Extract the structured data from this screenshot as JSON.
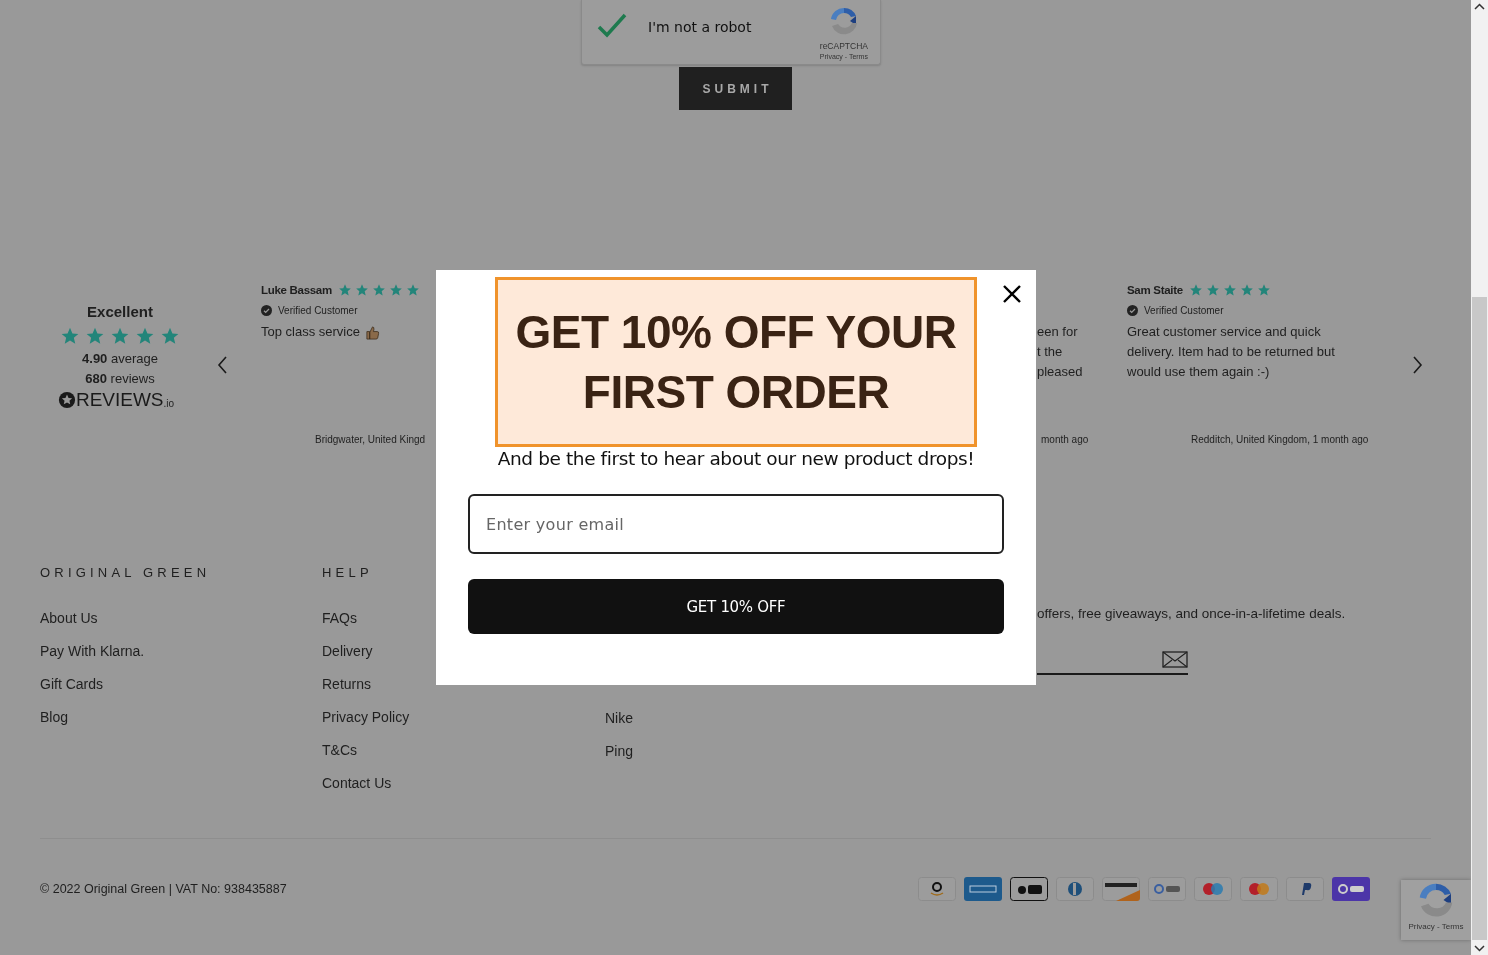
{
  "captcha": {
    "label": "I'm not a robot",
    "checked": true,
    "brand": "reCAPTCHA",
    "links": "Privacy - Terms"
  },
  "submit_button": "SUBMIT",
  "reviews": {
    "summary": {
      "rating_word": "Excellent",
      "stars": 5,
      "average": "**4.90** average",
      "count": "**680** reviews",
      "logo": "REVIEWS",
      "logo_suffix": ".io"
    },
    "items": [
      {
        "name": "Luke Bassam",
        "stars": 5,
        "badge": "Verified Customer",
        "text": "Top class service",
        "thumbs_up": true,
        "location": "Bridgwater, United Kingd"
      },
      {
        "name": "Sam Staite",
        "stars": 5,
        "badge": "Verified Customer",
        "text": "Great customer service and quick delivery. Item had to be returned but would use them again :-)",
        "thumbs_up": false,
        "location": "Redditch, United Kingdom, 1 month ago"
      }
    ],
    "partial_review": {
      "lines": [
        "een for",
        "t the",
        "pleased"
      ],
      "time": "month ago"
    }
  },
  "footer": {
    "columns": [
      {
        "heading": "ORIGINAL GREEN",
        "links": [
          "About Us",
          "Pay With Klarna.",
          "Gift Cards",
          "Blog"
        ]
      },
      {
        "heading": "HELP",
        "links": [
          "FAQs",
          "Delivery",
          "Returns",
          "Privacy Policy",
          "T&Cs",
          "Contact Us"
        ]
      },
      {
        "links": [
          "Nike",
          "Ping"
        ]
      }
    ],
    "newsletter": {
      "text": "offers, free giveaways, and once-in-a-lifetime deals."
    },
    "copyright": "© 2022 Original Green | VAT No: 938435887",
    "payment_methods": [
      {
        "kind": "amazon"
      },
      {
        "kind": "amex"
      },
      {
        "kind": "applepay"
      },
      {
        "kind": "diners"
      },
      {
        "kind": "discover"
      },
      {
        "kind": "googlepay"
      },
      {
        "kind": "maestro"
      },
      {
        "kind": "mastercard"
      },
      {
        "kind": "paypal"
      },
      {
        "kind": "shoppay"
      }
    ]
  },
  "recaptcha_badge": {
    "links": "Privacy - Terms"
  },
  "popup": {
    "heading": "GET 10% OFF YOUR FIRST ORDER",
    "subheading": "And be the first to hear about our new product drops!",
    "email_placeholder": "Enter your email",
    "button": "GET 10% OFF"
  }
}
